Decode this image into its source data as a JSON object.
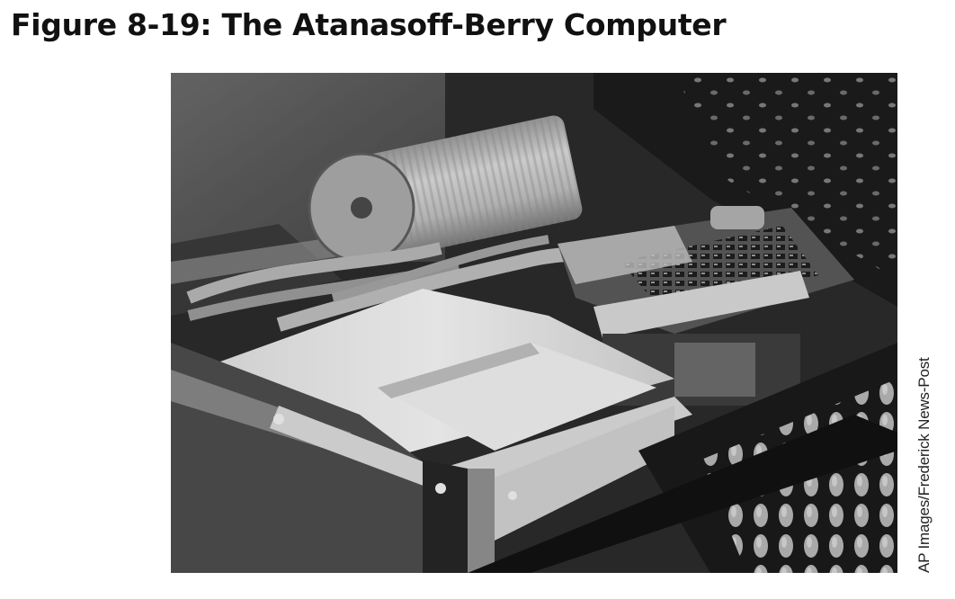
{
  "figure": {
    "title": "Figure 8-19: The Atanasoff-Berry Computer",
    "credit": "AP Images/Frederick News-Post"
  },
  "photo": {
    "subject": "Atanasoff-Berry Computer",
    "style": "black-and-white photograph"
  }
}
